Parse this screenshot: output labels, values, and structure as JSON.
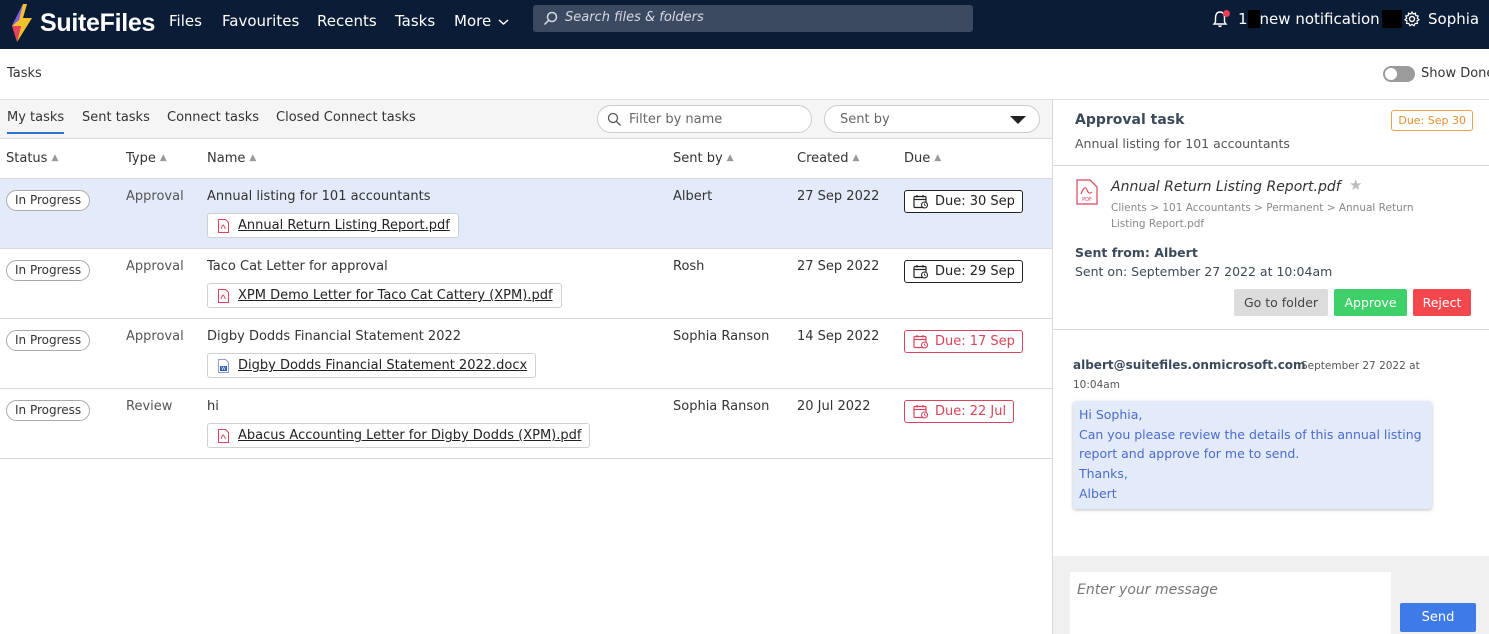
{
  "app": {
    "name": "SuiteFiles"
  },
  "nav": {
    "files": "Files",
    "favourites": "Favourites",
    "recents": "Recents",
    "tasks": "Tasks",
    "more": "More"
  },
  "search": {
    "placeholder": "Search files & folders"
  },
  "notifications": {
    "count": "1",
    "text": "new notification"
  },
  "user": {
    "name": "Sophia"
  },
  "page": {
    "title": "Tasks",
    "show_done_label": "Show Done"
  },
  "tabs": [
    "My tasks",
    "Sent tasks",
    "Connect tasks",
    "Closed Connect tasks"
  ],
  "filters": {
    "name_placeholder": "Filter by name",
    "sent_by_label": "Sent by"
  },
  "columns": {
    "status": "Status",
    "type": "Type",
    "name": "Name",
    "sent_by": "Sent by",
    "created": "Created",
    "due": "Due"
  },
  "rows": [
    {
      "status": "In Progress",
      "type": "Approval",
      "name": "Annual listing for 101 accountants",
      "file": "Annual Return Listing Report.pdf",
      "file_type": "pdf",
      "sent_by": "Albert",
      "created": "27 Sep 2022",
      "due": "Due: 30 Sep",
      "overdue": false
    },
    {
      "status": "In Progress",
      "type": "Approval",
      "name": "Taco Cat Letter for approval",
      "file": "XPM Demo Letter for Taco Cat Cattery (XPM).pdf",
      "file_type": "pdf",
      "sent_by": "Rosh",
      "created": "27 Sep 2022",
      "due": "Due: 29 Sep",
      "overdue": false
    },
    {
      "status": "In Progress",
      "type": "Approval",
      "name": "Digby Dodds Financial Statement 2022",
      "file": "Digby Dodds Financial Statement 2022.docx",
      "file_type": "docx",
      "sent_by": "Sophia Ranson",
      "created": "14 Sep 2022",
      "due": "Due: 17 Sep",
      "overdue": true
    },
    {
      "status": "In Progress",
      "type": "Review",
      "name": "hi",
      "file": "Abacus Accounting Letter for Digby Dodds (XPM).pdf",
      "file_type": "pdf",
      "sent_by": "Sophia Ranson",
      "created": "20 Jul 2022",
      "due": "Due: 22 Jul",
      "overdue": true
    }
  ],
  "detail": {
    "title": "Approval task",
    "subtitle": "Annual listing for 101 accountants",
    "due": "Due: Sep 30",
    "file_name": "Annual Return Listing Report.pdf",
    "file_path": "Clients > 101 Accountants > Permanent > Annual Return Listing Report.pdf",
    "sent_from": "Sent from: Albert",
    "sent_on": "Sent on: September 27 2022 at 10:04am",
    "buttons": {
      "go_to_folder": "Go to folder",
      "approve": "Approve",
      "reject": "Reject"
    }
  },
  "message": {
    "from": "albert@suitefiles.onmicrosoft.com",
    "date_line1": "September 27 2022 at",
    "date_line2": "10:04am",
    "lines": [
      "Hi Sophia,",
      "Can you please review the details of this annual listing",
      "report and approve for me to send.",
      "Thanks,",
      "Albert"
    ]
  },
  "composer": {
    "placeholder": "Enter your message",
    "send_label": "Send"
  },
  "colors": {
    "topbar": "#0b1c36",
    "selected_row": "#e3eaf9",
    "approve": "#3fd06a",
    "reject": "#f2474d",
    "send": "#3f7be8",
    "overdue": "#d9435b",
    "due_badge": "#e88d2f"
  },
  "icons": [
    "suitefiles-logo-icon",
    "chevron-down-icon",
    "search-icon",
    "bell-icon",
    "gear-icon",
    "sort-arrow-icon",
    "pdf-file-icon",
    "word-file-icon",
    "calendar-icon",
    "star-icon"
  ]
}
